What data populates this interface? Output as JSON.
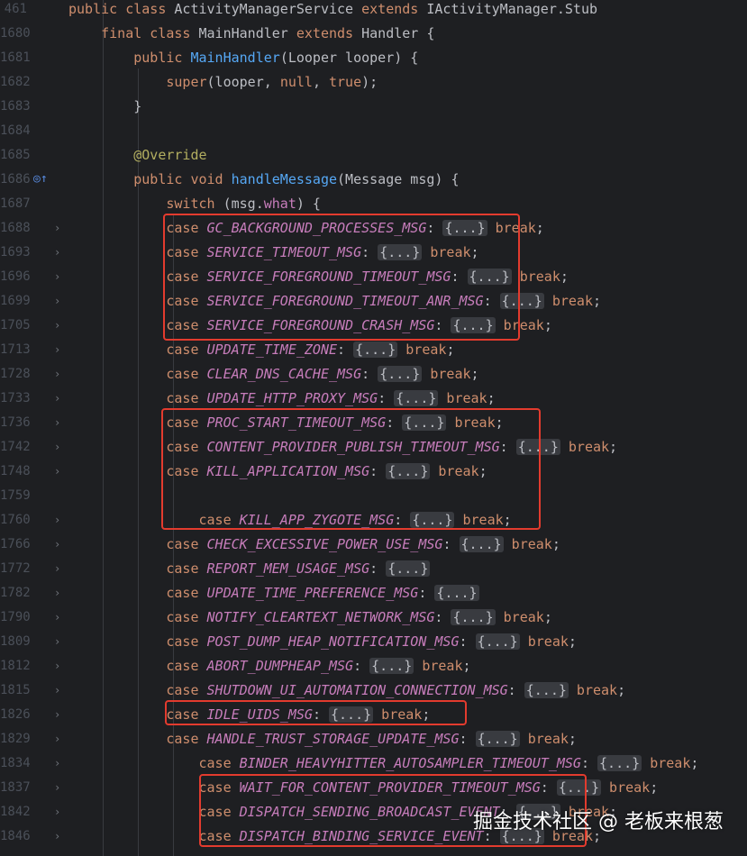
{
  "editor": {
    "lines": [
      {
        "num": "461",
        "fold": false,
        "parts": [
          [
            "kw",
            "public class "
          ],
          [
            "cls",
            "ActivityManagerService "
          ],
          [
            "kw",
            "extends "
          ],
          [
            "cls",
            "IActivityManager.Stub"
          ]
        ]
      },
      {
        "num": "1680",
        "fold": false,
        "parts": [
          [
            "kw",
            "    final class "
          ],
          [
            "cls",
            "MainHandler "
          ],
          [
            "kw",
            "extends "
          ],
          [
            "cls",
            "Handler {"
          ]
        ]
      },
      {
        "num": "1681",
        "fold": false,
        "parts": [
          [
            "kw",
            "        public "
          ],
          [
            "fn",
            "MainHandler"
          ],
          [
            "plain",
            "(Looper looper) {"
          ]
        ]
      },
      {
        "num": "1682",
        "fold": false,
        "parts": [
          [
            "kw",
            "            super"
          ],
          [
            "plain",
            "(looper, "
          ],
          [
            "kw",
            "null"
          ],
          [
            "plain",
            ", "
          ],
          [
            "kw",
            "true"
          ],
          [
            "plain",
            ");"
          ]
        ]
      },
      {
        "num": "1683",
        "fold": false,
        "parts": [
          [
            "plain",
            "        }"
          ]
        ]
      },
      {
        "num": "1684",
        "fold": false,
        "parts": []
      },
      {
        "num": "1685",
        "fold": false,
        "parts": [
          [
            "ann",
            "        @Override"
          ]
        ]
      },
      {
        "num": "1686",
        "fold": false,
        "icon": "◎↑",
        "parts": [
          [
            "kw",
            "        public void "
          ],
          [
            "fn",
            "handleMessage"
          ],
          [
            "plain",
            "(Message msg) {"
          ]
        ]
      },
      {
        "num": "1687",
        "fold": false,
        "parts": [
          [
            "kw",
            "            switch "
          ],
          [
            "plain",
            "(msg."
          ],
          [
            "fld",
            "what"
          ],
          [
            "plain",
            ") {"
          ]
        ]
      },
      {
        "num": "1688",
        "fold": true,
        "parts": [
          [
            "kw",
            "            case "
          ],
          [
            "const",
            "GC_BACKGROUND_PROCESSES_MSG"
          ],
          [
            "plain",
            ": "
          ],
          [
            "fold",
            "{...}"
          ],
          [
            "kw",
            " break"
          ],
          [
            "plain",
            ";"
          ]
        ]
      },
      {
        "num": "1693",
        "fold": true,
        "parts": [
          [
            "kw",
            "            case "
          ],
          [
            "const",
            "SERVICE_TIMEOUT_MSG"
          ],
          [
            "plain",
            ": "
          ],
          [
            "fold",
            "{...}"
          ],
          [
            "kw",
            " break"
          ],
          [
            "plain",
            ";"
          ]
        ]
      },
      {
        "num": "1696",
        "fold": true,
        "parts": [
          [
            "kw",
            "            case "
          ],
          [
            "const",
            "SERVICE_FOREGROUND_TIMEOUT_MSG"
          ],
          [
            "plain",
            ": "
          ],
          [
            "fold",
            "{...}"
          ],
          [
            "kw",
            " break"
          ],
          [
            "plain",
            ";"
          ]
        ]
      },
      {
        "num": "1699",
        "fold": true,
        "parts": [
          [
            "kw",
            "            case "
          ],
          [
            "const",
            "SERVICE_FOREGROUND_TIMEOUT_ANR_MSG"
          ],
          [
            "plain",
            ": "
          ],
          [
            "fold",
            "{...}"
          ],
          [
            "kw",
            " break"
          ],
          [
            "plain",
            ";"
          ]
        ]
      },
      {
        "num": "1705",
        "fold": true,
        "parts": [
          [
            "kw",
            "            case "
          ],
          [
            "const",
            "SERVICE_FOREGROUND_CRASH_MSG"
          ],
          [
            "plain",
            ": "
          ],
          [
            "fold",
            "{...}"
          ],
          [
            "kw",
            " break"
          ],
          [
            "plain",
            ";"
          ]
        ]
      },
      {
        "num": "1713",
        "fold": true,
        "parts": [
          [
            "kw",
            "            case "
          ],
          [
            "const",
            "UPDATE_TIME_ZONE"
          ],
          [
            "plain",
            ": "
          ],
          [
            "fold",
            "{...}"
          ],
          [
            "kw",
            " break"
          ],
          [
            "plain",
            ";"
          ]
        ]
      },
      {
        "num": "1728",
        "fold": true,
        "parts": [
          [
            "kw",
            "            case "
          ],
          [
            "const",
            "CLEAR_DNS_CACHE_MSG"
          ],
          [
            "plain",
            ": "
          ],
          [
            "fold",
            "{...}"
          ],
          [
            "kw",
            " break"
          ],
          [
            "plain",
            ";"
          ]
        ]
      },
      {
        "num": "1733",
        "fold": true,
        "parts": [
          [
            "kw",
            "            case "
          ],
          [
            "const",
            "UPDATE_HTTP_PROXY_MSG"
          ],
          [
            "plain",
            ": "
          ],
          [
            "fold",
            "{...}"
          ],
          [
            "kw",
            " break"
          ],
          [
            "plain",
            ";"
          ]
        ]
      },
      {
        "num": "1736",
        "fold": true,
        "parts": [
          [
            "kw",
            "            case "
          ],
          [
            "const",
            "PROC_START_TIMEOUT_MSG"
          ],
          [
            "plain",
            ": "
          ],
          [
            "fold",
            "{...}"
          ],
          [
            "kw",
            " break"
          ],
          [
            "plain",
            ";"
          ]
        ]
      },
      {
        "num": "1742",
        "fold": true,
        "parts": [
          [
            "kw",
            "            case "
          ],
          [
            "const",
            "CONTENT_PROVIDER_PUBLISH_TIMEOUT_MSG"
          ],
          [
            "plain",
            ": "
          ],
          [
            "fold",
            "{...}"
          ],
          [
            "kw",
            " break"
          ],
          [
            "plain",
            ";"
          ]
        ]
      },
      {
        "num": "1748",
        "fold": true,
        "parts": [
          [
            "kw",
            "            case "
          ],
          [
            "const",
            "KILL_APPLICATION_MSG"
          ],
          [
            "plain",
            ": "
          ],
          [
            "fold",
            "{...}"
          ],
          [
            "kw",
            " break"
          ],
          [
            "plain",
            ";"
          ]
        ]
      },
      {
        "num": "1759",
        "fold": false,
        "parts": []
      },
      {
        "num": "1760",
        "fold": true,
        "parts": [
          [
            "kw",
            "                case "
          ],
          [
            "const",
            "KILL_APP_ZYGOTE_MSG"
          ],
          [
            "plain",
            ": "
          ],
          [
            "fold",
            "{...}"
          ],
          [
            "kw",
            " break"
          ],
          [
            "plain",
            ";"
          ]
        ]
      },
      {
        "num": "1766",
        "fold": true,
        "parts": [
          [
            "kw",
            "            case "
          ],
          [
            "const",
            "CHECK_EXCESSIVE_POWER_USE_MSG"
          ],
          [
            "plain",
            ": "
          ],
          [
            "fold",
            "{...}"
          ],
          [
            "kw",
            " break"
          ],
          [
            "plain",
            ";"
          ]
        ]
      },
      {
        "num": "1772",
        "fold": true,
        "parts": [
          [
            "kw",
            "            case "
          ],
          [
            "const",
            "REPORT_MEM_USAGE_MSG"
          ],
          [
            "plain",
            ": "
          ],
          [
            "fold",
            "{...}"
          ]
        ]
      },
      {
        "num": "1782",
        "fold": true,
        "parts": [
          [
            "kw",
            "            case "
          ],
          [
            "const",
            "UPDATE_TIME_PREFERENCE_MSG"
          ],
          [
            "plain",
            ": "
          ],
          [
            "fold",
            "{...}"
          ]
        ]
      },
      {
        "num": "1790",
        "fold": true,
        "parts": [
          [
            "kw",
            "            case "
          ],
          [
            "const",
            "NOTIFY_CLEARTEXT_NETWORK_MSG"
          ],
          [
            "plain",
            ": "
          ],
          [
            "fold",
            "{...}"
          ],
          [
            "kw",
            " break"
          ],
          [
            "plain",
            ";"
          ]
        ]
      },
      {
        "num": "1809",
        "fold": true,
        "parts": [
          [
            "kw",
            "            case "
          ],
          [
            "const",
            "POST_DUMP_HEAP_NOTIFICATION_MSG"
          ],
          [
            "plain",
            ": "
          ],
          [
            "fold",
            "{...}"
          ],
          [
            "kw",
            " break"
          ],
          [
            "plain",
            ";"
          ]
        ]
      },
      {
        "num": "1812",
        "fold": true,
        "parts": [
          [
            "kw",
            "            case "
          ],
          [
            "const",
            "ABORT_DUMPHEAP_MSG"
          ],
          [
            "plain",
            ": "
          ],
          [
            "fold",
            "{...}"
          ],
          [
            "kw",
            " break"
          ],
          [
            "plain",
            ";"
          ]
        ]
      },
      {
        "num": "1815",
        "fold": true,
        "parts": [
          [
            "kw",
            "            case "
          ],
          [
            "const",
            "SHUTDOWN_UI_AUTOMATION_CONNECTION_MSG"
          ],
          [
            "plain",
            ": "
          ],
          [
            "fold",
            "{...}"
          ],
          [
            "kw",
            " break"
          ],
          [
            "plain",
            ";"
          ]
        ]
      },
      {
        "num": "1826",
        "fold": true,
        "parts": [
          [
            "kw",
            "            case "
          ],
          [
            "const",
            "IDLE_UIDS_MSG"
          ],
          [
            "plain",
            ": "
          ],
          [
            "fold",
            "{...}"
          ],
          [
            "kw",
            " break"
          ],
          [
            "plain",
            ";"
          ]
        ]
      },
      {
        "num": "1829",
        "fold": true,
        "parts": [
          [
            "kw",
            "            case "
          ],
          [
            "const",
            "HANDLE_TRUST_STORAGE_UPDATE_MSG"
          ],
          [
            "plain",
            ": "
          ],
          [
            "fold",
            "{...}"
          ],
          [
            "kw",
            " break"
          ],
          [
            "plain",
            ";"
          ]
        ]
      },
      {
        "num": "1834",
        "fold": true,
        "parts": [
          [
            "kw",
            "                case "
          ],
          [
            "const",
            "BINDER_HEAVYHITTER_AUTOSAMPLER_TIMEOUT_MSG"
          ],
          [
            "plain",
            ": "
          ],
          [
            "fold",
            "{...}"
          ],
          [
            "kw",
            " break"
          ],
          [
            "plain",
            ";"
          ]
        ]
      },
      {
        "num": "1837",
        "fold": true,
        "parts": [
          [
            "kw",
            "                case "
          ],
          [
            "const",
            "WAIT_FOR_CONTENT_PROVIDER_TIMEOUT_MSG"
          ],
          [
            "plain",
            ": "
          ],
          [
            "fold",
            "{...}"
          ],
          [
            "kw",
            " break"
          ],
          [
            "plain",
            ";"
          ]
        ]
      },
      {
        "num": "1842",
        "fold": true,
        "parts": [
          [
            "kw",
            "                case "
          ],
          [
            "const",
            "DISPATCH_SENDING_BROADCAST_EVENT"
          ],
          [
            "plain",
            ": "
          ],
          [
            "fold",
            "{...}"
          ],
          [
            "kw",
            " break"
          ],
          [
            "plain",
            ";"
          ]
        ]
      },
      {
        "num": "1846",
        "fold": true,
        "parts": [
          [
            "kw",
            "                case "
          ],
          [
            "const",
            "DISPATCH_BINDING_SERVICE_EVENT"
          ],
          [
            "plain",
            ": "
          ],
          [
            "fold",
            "{...}"
          ],
          [
            "kw",
            " break"
          ],
          [
            "plain",
            ";"
          ]
        ]
      }
    ]
  },
  "watermark": "掘金技术社区 @ 老板来根葱",
  "colors": {
    "background": "#1e1f22",
    "keyword": "#cf8e6d",
    "constant": "#c77dbb",
    "function": "#56a8f5",
    "annotation": "#b3ae60",
    "highlight": "#e33b2e"
  }
}
